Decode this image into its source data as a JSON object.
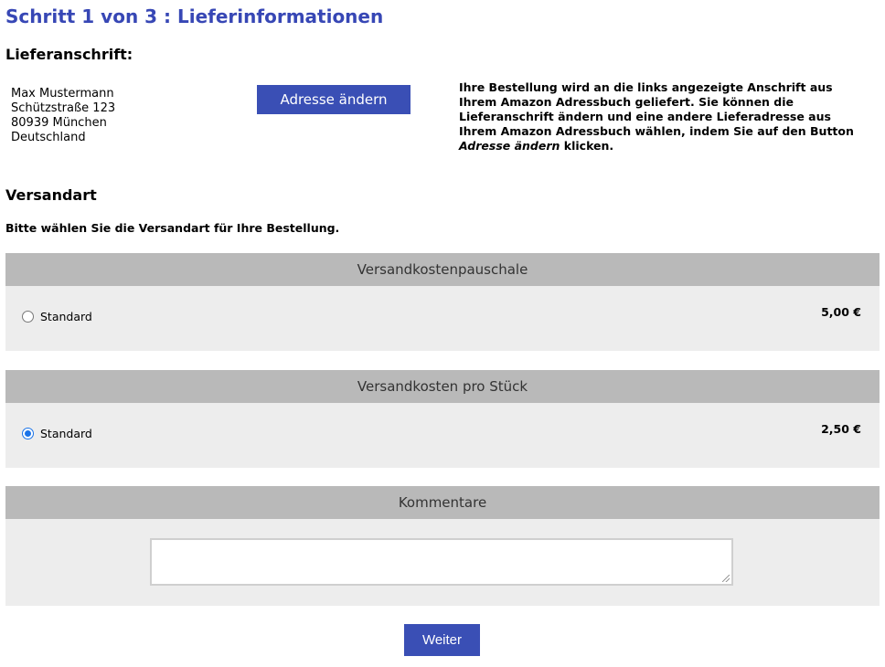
{
  "page_title": "Schritt 1 von 3 : Lieferinformationen",
  "delivery": {
    "heading": "Lieferanschrift:",
    "address_lines": [
      "Max Mustermann",
      "Schützstraße 123",
      "80939 München",
      "Deutschland"
    ],
    "change_button": "Adresse ändern",
    "info_text": "Ihre Bestellung wird an die links angezeigte Anschrift aus Ihrem Amazon Adressbuch geliefert. Sie können die Lieferanschrift ändern und eine andere Lieferadresse aus Ihrem Amazon Adressbuch wählen, indem Sie auf den Button ",
    "info_emph": "Adresse ändern",
    "info_end": " klicken."
  },
  "shipping": {
    "heading": "Versandart",
    "instruction": "Bitte wählen Sie die Versandart für Ihre Bestellung.",
    "groups": [
      {
        "header": "Versandkostenpauschale",
        "option_label": "Standard",
        "price": "5,00 €",
        "selected": false
      },
      {
        "header": "Versandkosten pro Stück",
        "option_label": "Standard",
        "price": "2,50 €",
        "selected": true
      }
    ]
  },
  "comments": {
    "header": "Kommentare",
    "value": ""
  },
  "next_button": "Weiter"
}
